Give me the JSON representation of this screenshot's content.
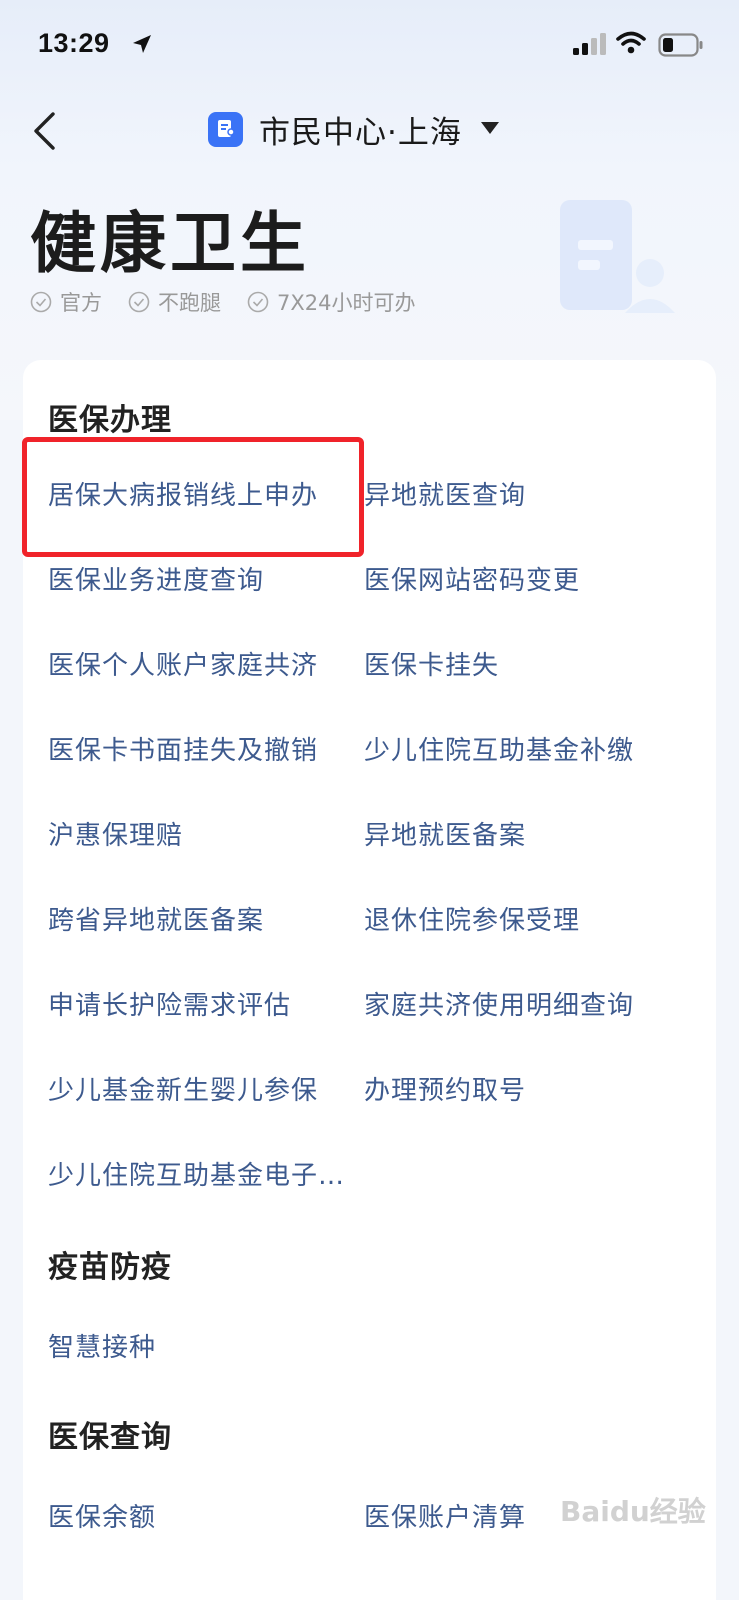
{
  "status_bar": {
    "time": "13:29"
  },
  "nav": {
    "title": "市民中心·上海"
  },
  "header": {
    "title": "健康卫生",
    "tags": [
      "官方",
      "不跑腿",
      "7X24小时可办"
    ]
  },
  "sections": [
    {
      "title": "医保办理",
      "items": [
        "居保大病报销线上申办",
        "异地就医查询",
        "医保业务进度查询",
        "医保网站密码变更",
        "医保个人账户家庭共济",
        "医保卡挂失",
        "医保卡书面挂失及撤销",
        "少儿住院互助基金补缴",
        "沪惠保理赔",
        "异地就医备案",
        "跨省异地就医备案",
        "退休住院参保受理",
        "申请长护险需求评估",
        "家庭共济使用明细查询",
        "少儿基金新生婴儿参保",
        "办理预约取号",
        "少儿住院互助基金电子…"
      ]
    },
    {
      "title": "疫苗防疫",
      "items": [
        "智慧接种"
      ]
    },
    {
      "title": "医保查询",
      "items": [
        "医保余额",
        "医保账户清算"
      ]
    }
  ],
  "watermark": "Baidu经验",
  "colors": {
    "accent": "#3a73f6",
    "link": "#3d5a8e",
    "highlight": "#f0232a"
  },
  "icons": [
    "location-arrow-icon",
    "signal-icon",
    "wifi-icon",
    "battery-icon",
    "back-chevron-icon",
    "app-doc-icon",
    "dropdown-triangle-icon",
    "check-circle-icon"
  ]
}
